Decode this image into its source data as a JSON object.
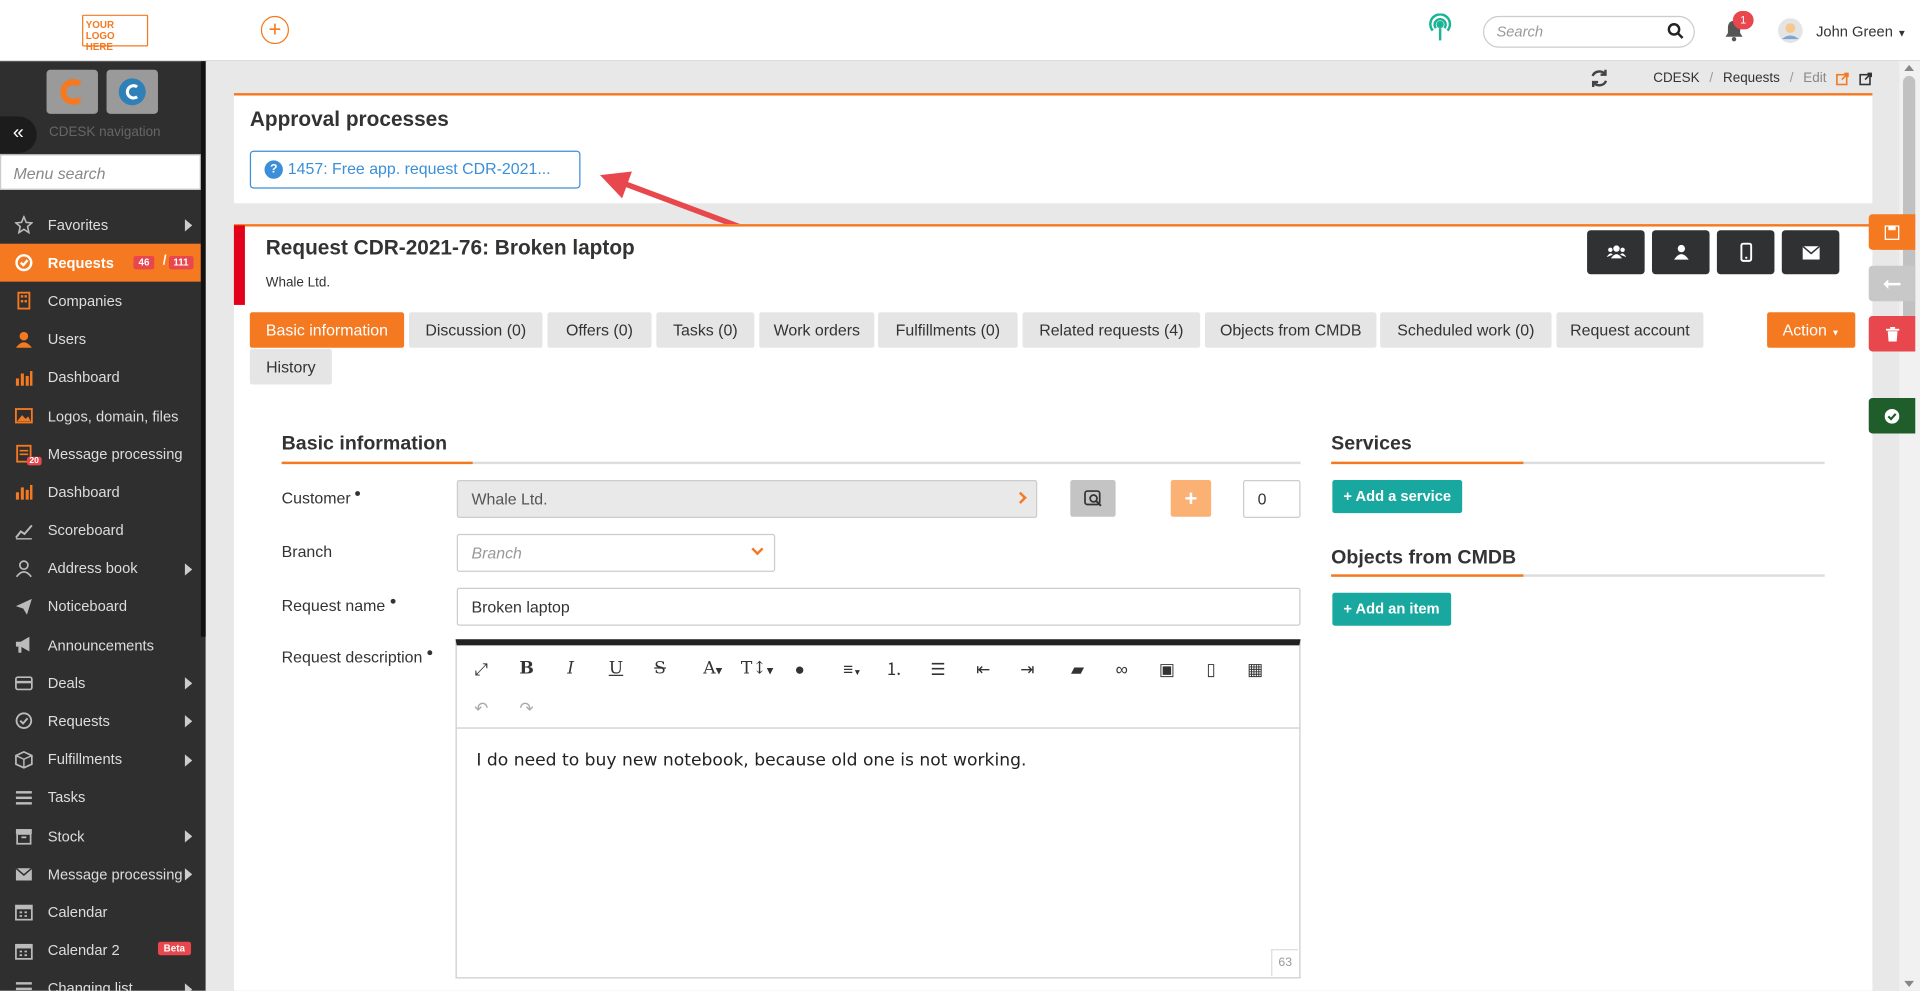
{
  "topbar": {
    "logo_text": "YOUR LOGO HERE",
    "search_placeholder": "Search",
    "notifications_count": "1",
    "user_name": "John Green"
  },
  "sidebar": {
    "nav_title": "CDESK navigation",
    "menu_search_placeholder": "Menu search",
    "items": [
      {
        "label": "Favorites",
        "icon": "star-icon",
        "arrow": true
      },
      {
        "label": "Requests",
        "icon": "requests-icon",
        "active": true,
        "count_a": "46",
        "count_b": "111"
      },
      {
        "label": "Companies",
        "icon": "building-icon"
      },
      {
        "label": "Users",
        "icon": "user-icon"
      },
      {
        "label": "Dashboard",
        "icon": "bar-chart-icon"
      },
      {
        "label": "Logos, domain, files",
        "icon": "image-icon"
      },
      {
        "label": "Message processing",
        "icon": "message-icon",
        "badge": "20"
      },
      {
        "label": "Dashboard",
        "icon": "bar-chart-icon"
      },
      {
        "label": "Scoreboard",
        "icon": "line-chart-icon"
      },
      {
        "label": "Address book",
        "icon": "person-outline-icon",
        "arrow": true
      },
      {
        "label": "Noticeboard",
        "icon": "paper-plane-icon"
      },
      {
        "label": "Announcements",
        "icon": "bullhorn-icon"
      },
      {
        "label": "Deals",
        "icon": "card-icon",
        "arrow": true
      },
      {
        "label": "Requests",
        "icon": "check-circle-icon",
        "arrow": true
      },
      {
        "label": "Fulfillments",
        "icon": "cube-icon",
        "arrow": true
      },
      {
        "label": "Tasks",
        "icon": "list-icon"
      },
      {
        "label": "Stock",
        "icon": "box-icon",
        "arrow": true
      },
      {
        "label": "Message processing",
        "icon": "envelope-icon",
        "arrow": true
      },
      {
        "label": "Calendar",
        "icon": "calendar-icon"
      },
      {
        "label": "Calendar 2",
        "icon": "calendar-icon",
        "beta": "Beta"
      },
      {
        "label": "Changing list",
        "icon": "list-icon",
        "arrow": true
      }
    ]
  },
  "breadcrumb": {
    "items": [
      "CDESK",
      "Requests",
      "Edit"
    ]
  },
  "approval": {
    "title": "Approval processes",
    "item_label": "1457: Free app. request CDR-2021..."
  },
  "request": {
    "title": "Request CDR-2021-76: Broken laptop",
    "company": "Whale Ltd.",
    "action_label": "Action",
    "tabs": [
      "Basic information",
      "Discussion (0)",
      "Offers (0)",
      "Tasks (0)",
      "Work orders",
      "Fulfillments (0)",
      "Related requests (4)",
      "Objects from CMDB",
      "Scheduled work (0)",
      "Request account",
      "History"
    ]
  },
  "form": {
    "section_title": "Basic information",
    "customer_label": "Customer",
    "customer_value": "Whale Ltd.",
    "customer_count": "0",
    "branch_label": "Branch",
    "branch_placeholder": "Branch",
    "request_name_label": "Request name",
    "request_name_value": "Broken laptop",
    "description_label": "Request description",
    "description_value": "I do need to buy new notebook, because old one is not working.",
    "char_count": "63"
  },
  "services": {
    "title": "Services",
    "add_service_label": "+ Add a service",
    "cmdb_title": "Objects from CMDB",
    "add_item_label": "+ Add an item"
  },
  "colors": {
    "accent": "#f47920",
    "sidebar": "#2f2f2f",
    "teal": "#19a8a0",
    "danger": "#e8474d",
    "link": "#3a8fd8"
  }
}
